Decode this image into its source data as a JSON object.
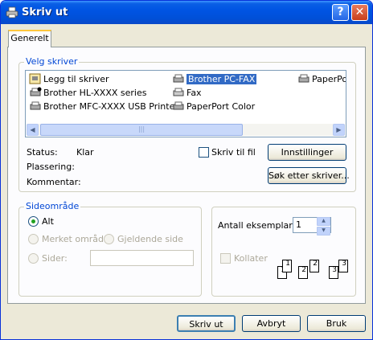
{
  "window": {
    "title": "Skriv ut",
    "help_glyph": "?",
    "close_glyph": "✕"
  },
  "tabs": [
    {
      "label": "Generelt"
    }
  ],
  "printer_group": {
    "label": "Velg skriver",
    "printers": [
      {
        "label": "Legg til skriver",
        "icon": "add-printer-icon"
      },
      {
        "label": "Brother HL-XXXX series",
        "icon": "printer-default-icon"
      },
      {
        "label": "Brother MFC-XXXX  USB Printer",
        "icon": "printer-icon"
      },
      {
        "label": "Brother PC-FAX",
        "icon": "fax-printer-icon",
        "selected": true
      },
      {
        "label": "Fax",
        "icon": "fax-icon"
      },
      {
        "label": "PaperPort Color",
        "icon": "printer-icon"
      },
      {
        "label": "PaperPo",
        "icon": "printer-icon"
      }
    ],
    "status_label": "Status:",
    "status_value": "Klar",
    "location_label": "Plassering:",
    "comment_label": "Kommentar:",
    "print_to_file_label": "Skriv til fil",
    "settings_button": "Innstillinger",
    "find_printer_button": "Søk etter skriver..."
  },
  "range_group": {
    "label": "Sideområde",
    "options": {
      "all": "Alt",
      "selection": "Merket område",
      "current": "Gjeldende side",
      "pages": "Sider:"
    },
    "selected": "all"
  },
  "copies_group": {
    "copies_label": "Antall eksemplarer:",
    "copies_value": "1",
    "collate_label": "Kollater",
    "collate_pages": [
      "1",
      "1",
      "2",
      "2",
      "3",
      "3"
    ]
  },
  "buttons": {
    "print": "Skriv ut",
    "cancel": "Avbryt",
    "apply": "Bruk"
  },
  "scroll_glyphs": {
    "left": "◀",
    "right": "▶",
    "up": "▲",
    "down": "▼",
    "grip": "|||"
  }
}
